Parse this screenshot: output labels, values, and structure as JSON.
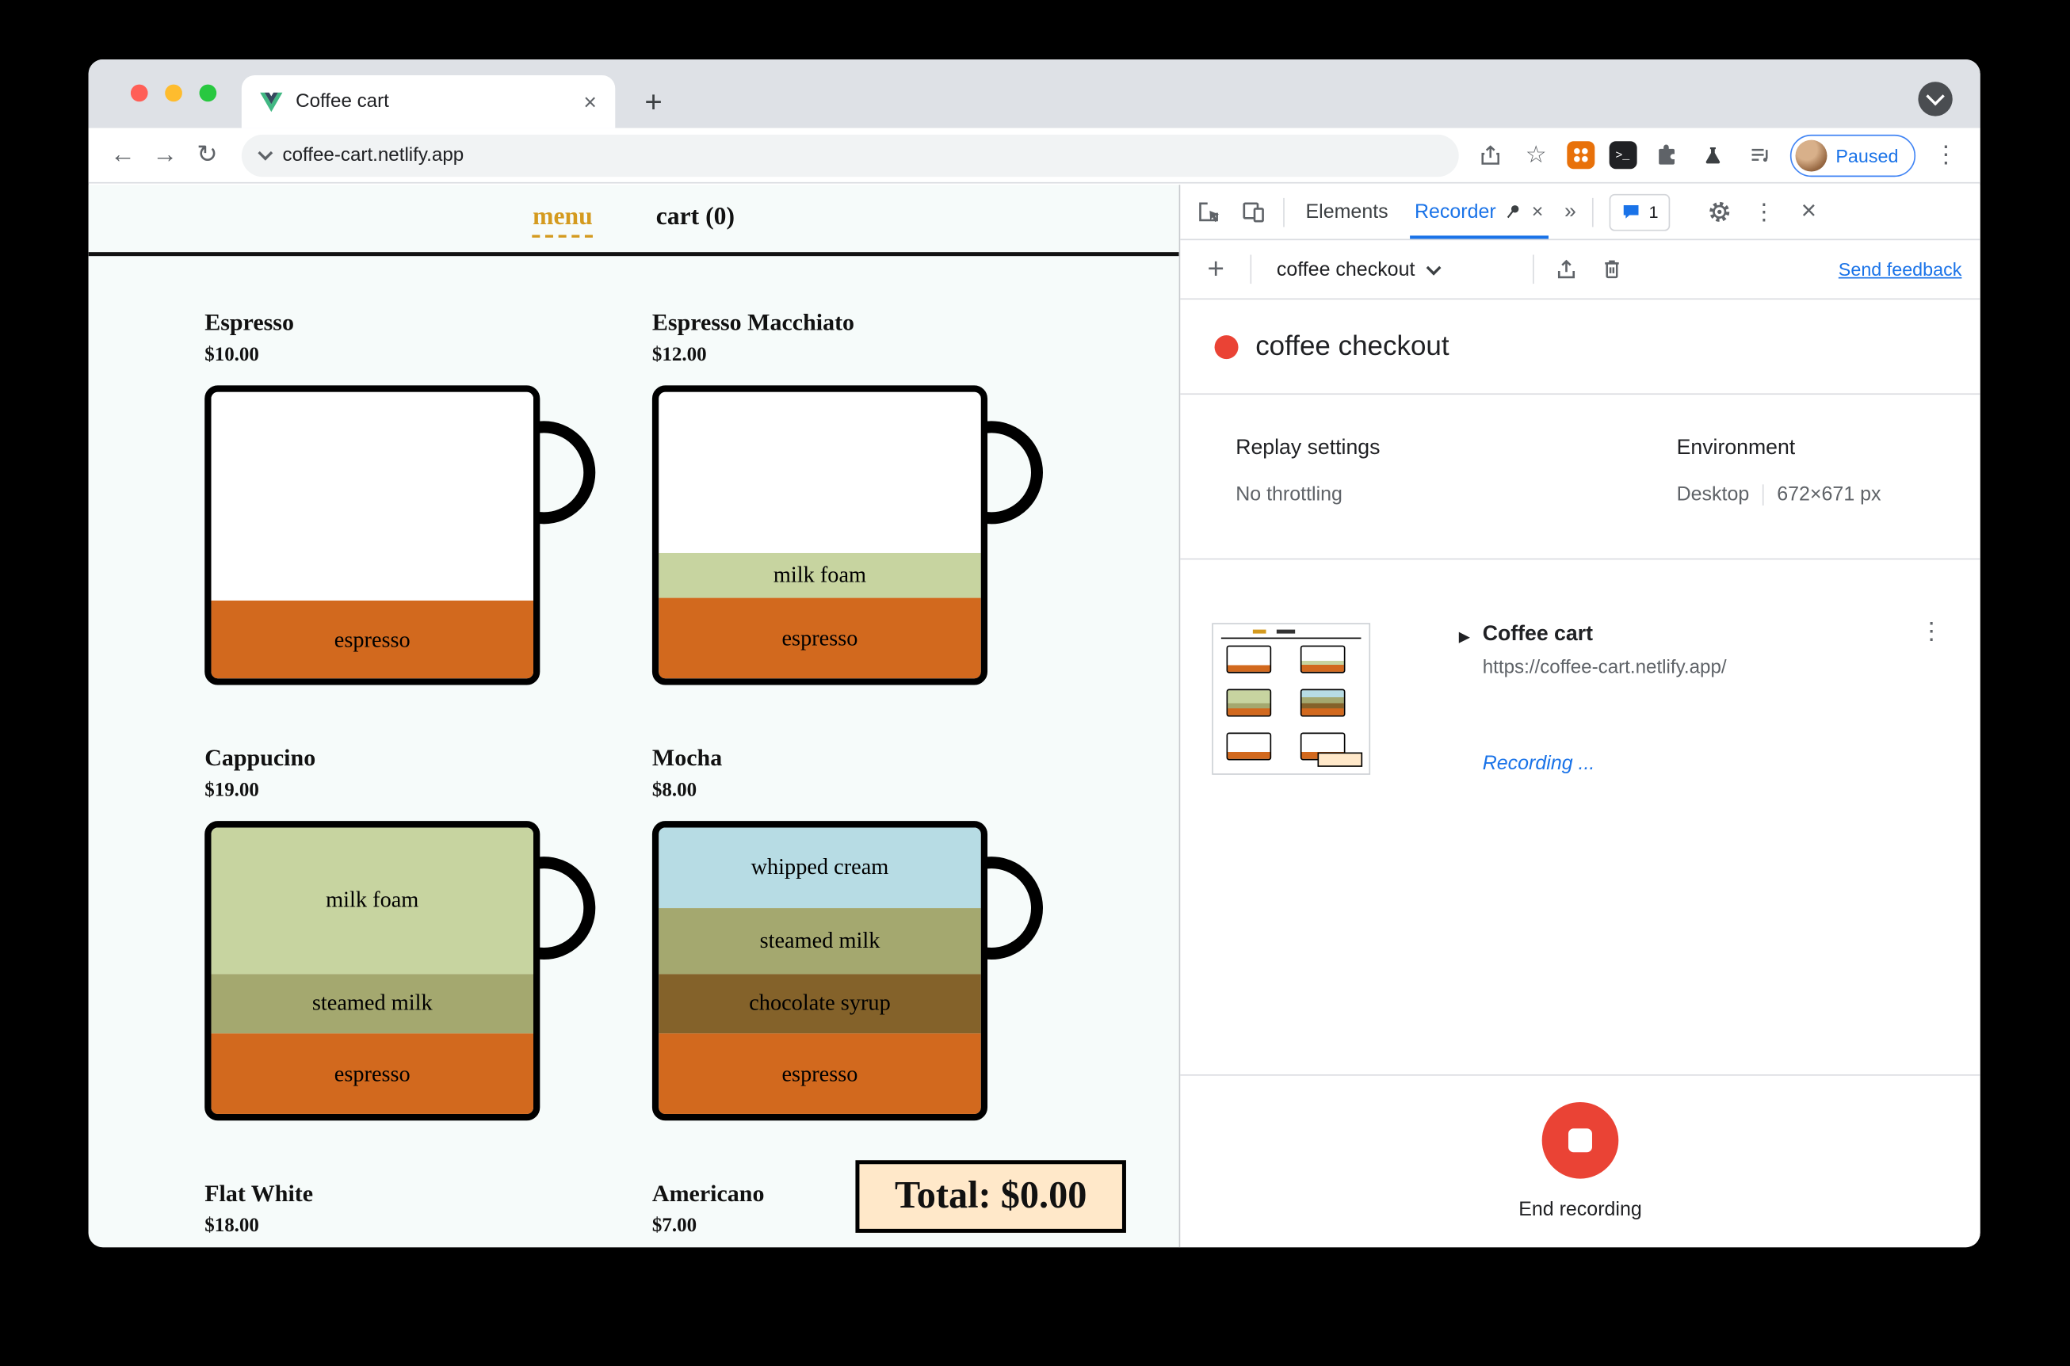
{
  "icons": {
    "close": "×",
    "plus": "+",
    "kebab": "⋮",
    "back": "←",
    "forward": "→",
    "reload": "↻",
    "star": "☆",
    "more_tabs": "»",
    "expand": "▶",
    "terminal": ">_"
  },
  "chrome": {
    "tab": {
      "title": "Coffee cart"
    },
    "toolbar": {
      "url": "coffee-cart.netlify.app",
      "profile_label": "Paused"
    }
  },
  "page": {
    "nav": {
      "menu_label": "menu",
      "cart_label": "cart (0)"
    },
    "total_label": "Total: $0.00",
    "items": [
      {
        "name": "Espresso",
        "price": "$10.00",
        "layers": [
          {
            "label": "",
            "color": "#FFFFFF",
            "pct": 73
          },
          {
            "label": "espresso",
            "color": "#D2691E",
            "pct": 27
          }
        ]
      },
      {
        "name": "Espresso Macchiato",
        "price": "$12.00",
        "layers": [
          {
            "label": "",
            "color": "#FFFFFF",
            "pct": 56
          },
          {
            "label": "milk foam",
            "color": "#C7D4A0",
            "pct": 16
          },
          {
            "label": "espresso",
            "color": "#D2691E",
            "pct": 28
          }
        ]
      },
      {
        "name": "Cappucino",
        "price": "$19.00",
        "layers": [
          {
            "label": "milk foam",
            "color": "#C7D4A0",
            "pct": 51
          },
          {
            "label": "steamed milk",
            "color": "#A4A86F",
            "pct": 21
          },
          {
            "label": "espresso",
            "color": "#D2691E",
            "pct": 28
          }
        ]
      },
      {
        "name": "Mocha",
        "price": "$8.00",
        "layers": [
          {
            "label": "whipped cream",
            "color": "#B7DCE4",
            "pct": 28
          },
          {
            "label": "steamed milk",
            "color": "#A4A86F",
            "pct": 23
          },
          {
            "label": "chocolate syrup",
            "color": "#84622A",
            "pct": 21
          },
          {
            "label": "espresso",
            "color": "#D2691E",
            "pct": 28
          }
        ]
      },
      {
        "name": "Flat White",
        "price": "$18.00",
        "layers": []
      },
      {
        "name": "Americano",
        "price": "$7.00",
        "layers": []
      }
    ]
  },
  "devtools": {
    "tabs": {
      "elements": "Elements",
      "recorder": "Recorder",
      "console_badge": "1"
    },
    "recorder_bar": {
      "recording_select": "coffee checkout",
      "send_feedback": "Send feedback"
    },
    "recording": {
      "title": "coffee checkout"
    },
    "settings": {
      "replay_title": "Replay settings",
      "replay_value": "No throttling",
      "env_title": "Environment",
      "env_device": "Desktop",
      "env_size": "672×671 px"
    },
    "step": {
      "title": "Coffee cart",
      "url": "https://coffee-cart.netlify.app/",
      "status": "Recording ..."
    },
    "footer": {
      "end_label": "End recording"
    }
  }
}
